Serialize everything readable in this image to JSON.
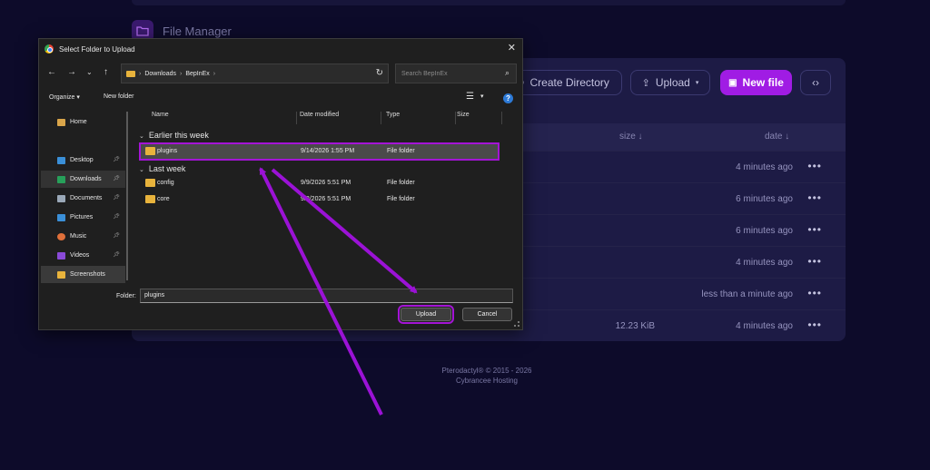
{
  "app": {
    "title": "File Manager",
    "toolbar": {
      "create_directory": "Create Directory",
      "upload": "Upload",
      "new_file": "New file",
      "code_icon": "code-icon"
    },
    "table": {
      "col_size": "size ↓",
      "col_date": "date ↓",
      "rows": [
        {
          "size": "",
          "date": "4 minutes ago"
        },
        {
          "size": "",
          "date": "6 minutes ago"
        },
        {
          "size": "",
          "date": "6 minutes ago"
        },
        {
          "size": "",
          "date": "4 minutes ago"
        },
        {
          "size": "",
          "date": "less than a minute ago"
        },
        {
          "size": "12.23 KiB",
          "date": "4 minutes ago"
        }
      ]
    },
    "footer": {
      "line1": "Pterodactyl® © 2015 - 2026",
      "line2": "Cybrancee Hosting"
    }
  },
  "dialog": {
    "title": "Select Folder to Upload",
    "breadcrumb": [
      "Downloads",
      "BepInEx"
    ],
    "search_placeholder": "Search BepInEx",
    "organize": "Organize ▾",
    "new_folder": "New folder",
    "sidebar": [
      {
        "label": "Home",
        "icon": "home-icon",
        "color": "#d9a54a",
        "pinned": false
      },
      {
        "label": "Desktop",
        "icon": "desktop-icon",
        "color": "#3a8fd8",
        "pinned": true
      },
      {
        "label": "Downloads",
        "icon": "download-icon",
        "color": "#27a05a",
        "pinned": true
      },
      {
        "label": "Documents",
        "icon": "document-icon",
        "color": "#9aa8b8",
        "pinned": true
      },
      {
        "label": "Pictures",
        "icon": "pictures-icon",
        "color": "#3a8fd8",
        "pinned": true
      },
      {
        "label": "Music",
        "icon": "music-icon",
        "color": "#e0703a",
        "pinned": true
      },
      {
        "label": "Videos",
        "icon": "videos-icon",
        "color": "#8a4ad8",
        "pinned": true
      },
      {
        "label": "Screenshots",
        "icon": "folder-icon",
        "color": "#e8b33c",
        "pinned": false
      }
    ],
    "columns": {
      "name": "Name",
      "date_modified": "Date modified",
      "type": "Type",
      "size": "Size"
    },
    "groups": [
      {
        "label": "Earlier this week",
        "items": [
          {
            "name": "plugins",
            "date": "9/14/2026 1:55 PM",
            "type": "File folder",
            "selected": true
          }
        ]
      },
      {
        "label": "Last week",
        "items": [
          {
            "name": "config",
            "date": "9/9/2026 5:51 PM",
            "type": "File folder",
            "selected": false
          },
          {
            "name": "core",
            "date": "9/3/2026 5:51 PM",
            "type": "File folder",
            "selected": false
          }
        ]
      }
    ],
    "folder_label": "Folder:",
    "folder_value": "plugins",
    "upload_button": "Upload",
    "cancel_button": "Cancel"
  },
  "colors": {
    "accent": "#a01ce4",
    "annotation": "#9b12d6",
    "background": "#0d0b2a"
  }
}
